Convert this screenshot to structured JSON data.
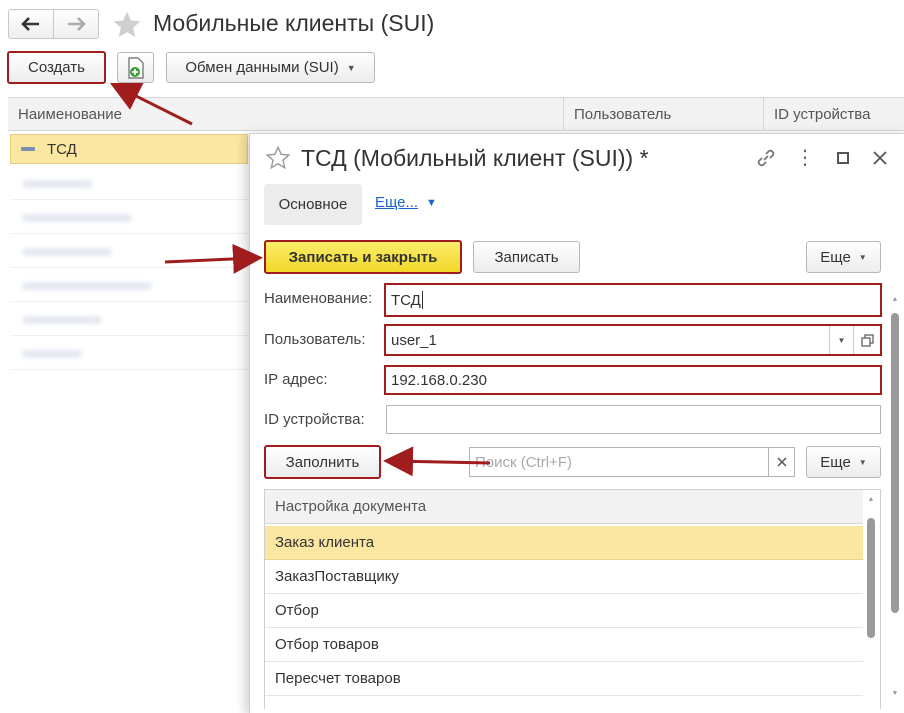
{
  "window": {
    "title": "Мобильные клиенты (SUI)",
    "back_icon": "arrow-left-icon",
    "forward_icon": "arrow-right-icon",
    "star_icon": "star-icon"
  },
  "toolbar": {
    "create_label": "Создать",
    "exchange_label": "Обмен данными (SUI)"
  },
  "list": {
    "columns": [
      "Наименование",
      "Пользователь",
      "ID устройства"
    ],
    "selected_item": "ТСД"
  },
  "form": {
    "title": "ТСД (Мобильный клиент (SUI)) *",
    "tabs": {
      "main": "Основное",
      "more": "Еще..."
    },
    "buttons": {
      "save_close": "Записать и закрыть",
      "save": "Записать",
      "more": "Еще",
      "fill": "Заполнить",
      "more2": "Еще"
    },
    "fields": {
      "name_label": "Наименование:",
      "name_value": "ТСД",
      "user_label": "Пользователь:",
      "user_value": "user_1",
      "ip_label": "IP адрес:",
      "ip_value": "192.168.0.230",
      "device_label": "ID устройства:",
      "device_value": ""
    },
    "search_placeholder": "Поиск (Ctrl+F)",
    "table": {
      "header": "Настройка документа",
      "rows": [
        "Заказ клиента",
        "ЗаказПоставщику",
        "Отбор",
        "Отбор товаров",
        "Пересчет товаров"
      ]
    }
  },
  "colors": {
    "accent_yellow": "#f5e34a",
    "selection_yellow": "#fbe7a1",
    "annotation_red": "#a11c1c",
    "link_blue": "#1a64c8"
  }
}
